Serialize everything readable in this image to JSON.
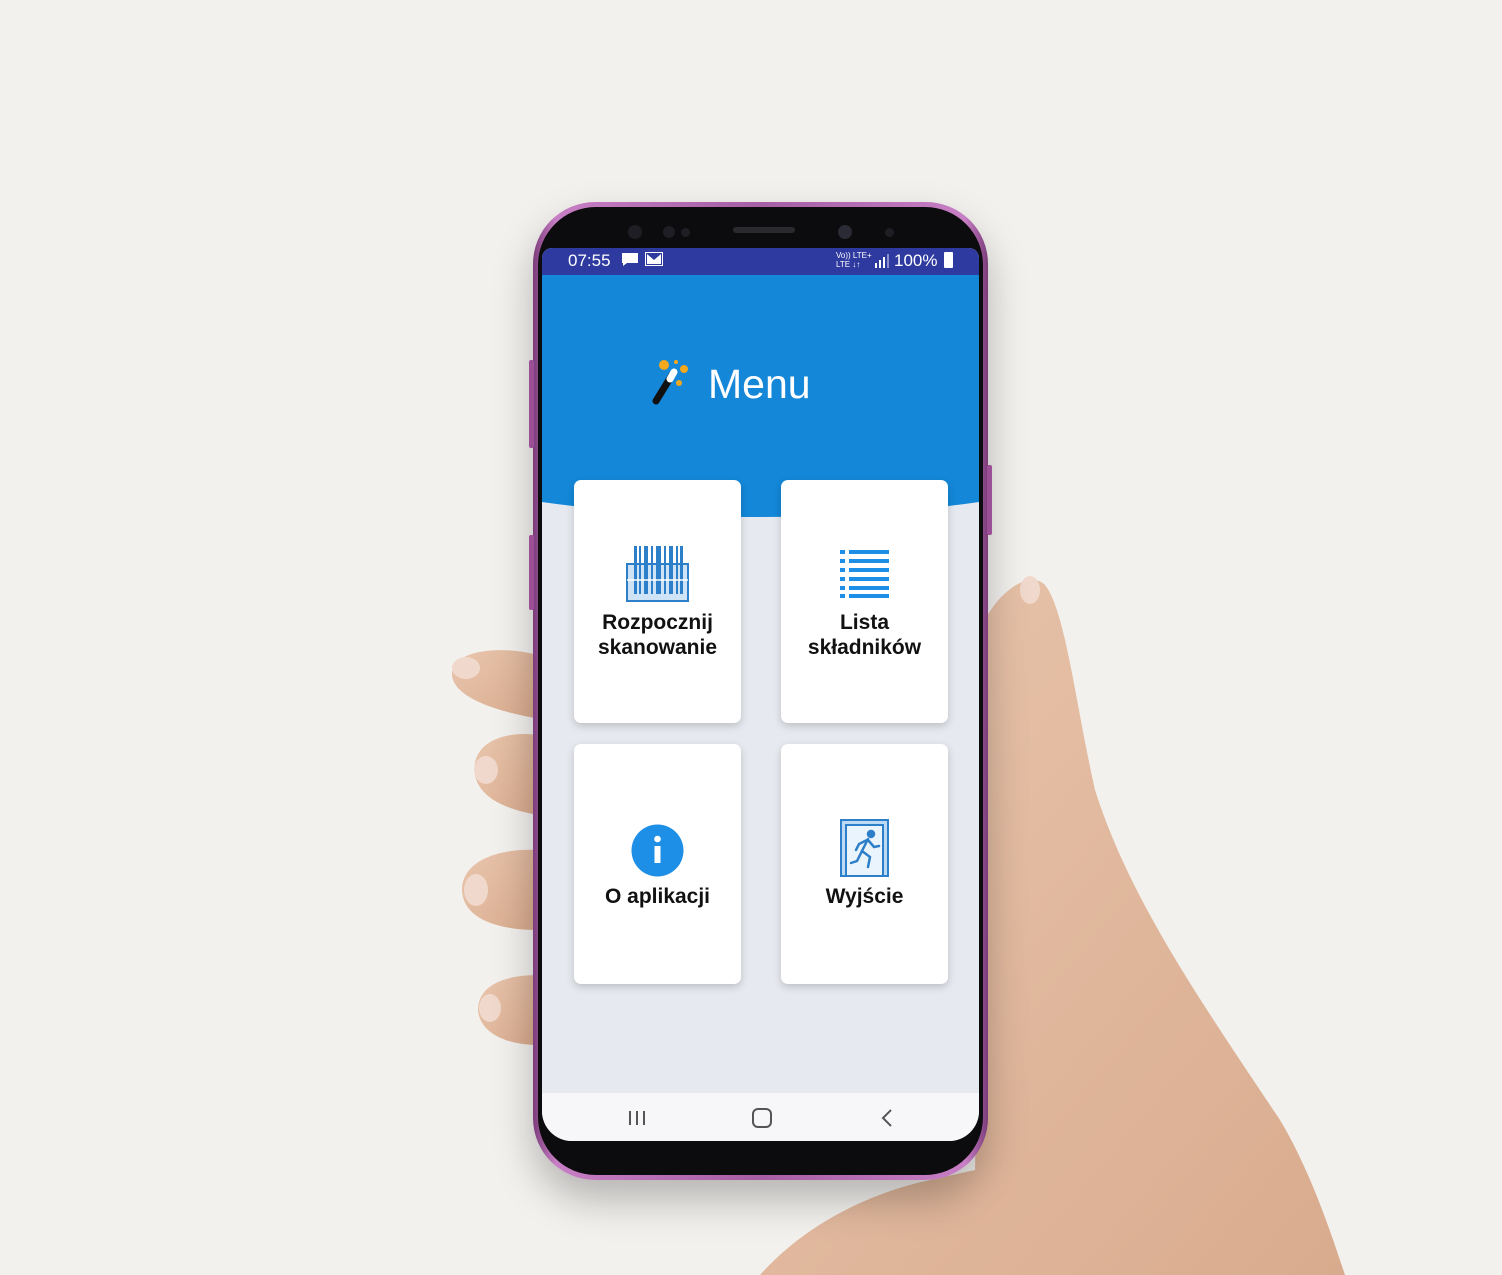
{
  "status_bar": {
    "time": "07:55",
    "network_top": "Vo)) LTE+",
    "network_bottom": "LTE ↓↑",
    "battery": "100%"
  },
  "header": {
    "title": "Menu",
    "icon": "magic-wand-icon",
    "color": "#1487d8"
  },
  "menu": {
    "items": [
      {
        "line1": "Rozpocznij",
        "line2": "skanowanie",
        "icon": "barcode-scan-icon"
      },
      {
        "line1": "Lista",
        "line2": "składników",
        "icon": "list-icon"
      },
      {
        "label": "O aplikacji",
        "icon": "info-icon"
      },
      {
        "label": "Wyjście",
        "icon": "exit-icon"
      }
    ]
  },
  "nav_bar": {
    "recents": "recent-apps-icon",
    "home": "home-icon",
    "back": "back-icon"
  },
  "colors": {
    "accent_blue": "#1487d8",
    "status_bar": "#2e3aa0",
    "screen_bg": "#e6e9ef",
    "phone_frame": "#b06aad"
  }
}
